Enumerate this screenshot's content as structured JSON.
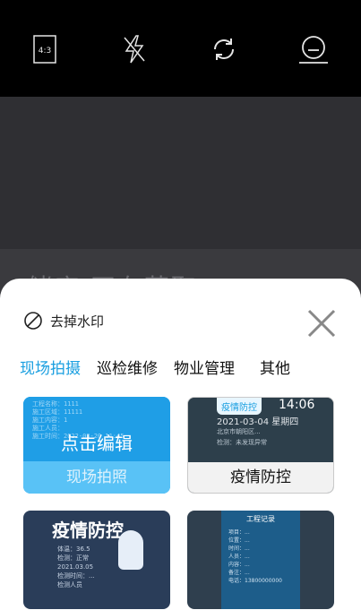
{
  "camera": {
    "ratio_label": "4:3",
    "icons": [
      "aspect-ratio-icon",
      "flash-off-icon",
      "switch-camera-icon",
      "profile-icon"
    ]
  },
  "preview": {
    "ghost_text": "储库  正在获取"
  },
  "sheet": {
    "watermark_toggle_label": "去掉水印",
    "tabs": [
      {
        "label": "现场拍摄",
        "active": true
      },
      {
        "label": "巡检维修",
        "active": false
      },
      {
        "label": "物业管理",
        "active": false
      },
      {
        "label": "其他",
        "active": false
      }
    ],
    "cards": [
      {
        "caption": "现场拍照",
        "overlay": "点击编辑",
        "lines": [
          "工程名称：1111",
          "施工区域：11111",
          "施工内容：1",
          "施工人员：",
          "施工时间：2022-03-20 11:45"
        ]
      },
      {
        "caption": "疫情防控",
        "badge": "疫情防控",
        "time": "14:06",
        "date": "2021-03-04 星期四",
        "lines": [
          "北京市朝阳区...",
          "检测：未发现异常"
        ]
      },
      {
        "title": "疫情防控",
        "lines": [
          "体温：36.5",
          "检测：正常",
          "2021.03.05",
          "检测时间：...",
          "检测人员"
        ]
      },
      {
        "title": "工程记录",
        "lines": [
          "项目：...",
          "位置：...",
          "时间：...",
          "人员：...",
          "内容：...",
          "备注：...",
          "电话：13800000000"
        ]
      }
    ]
  }
}
